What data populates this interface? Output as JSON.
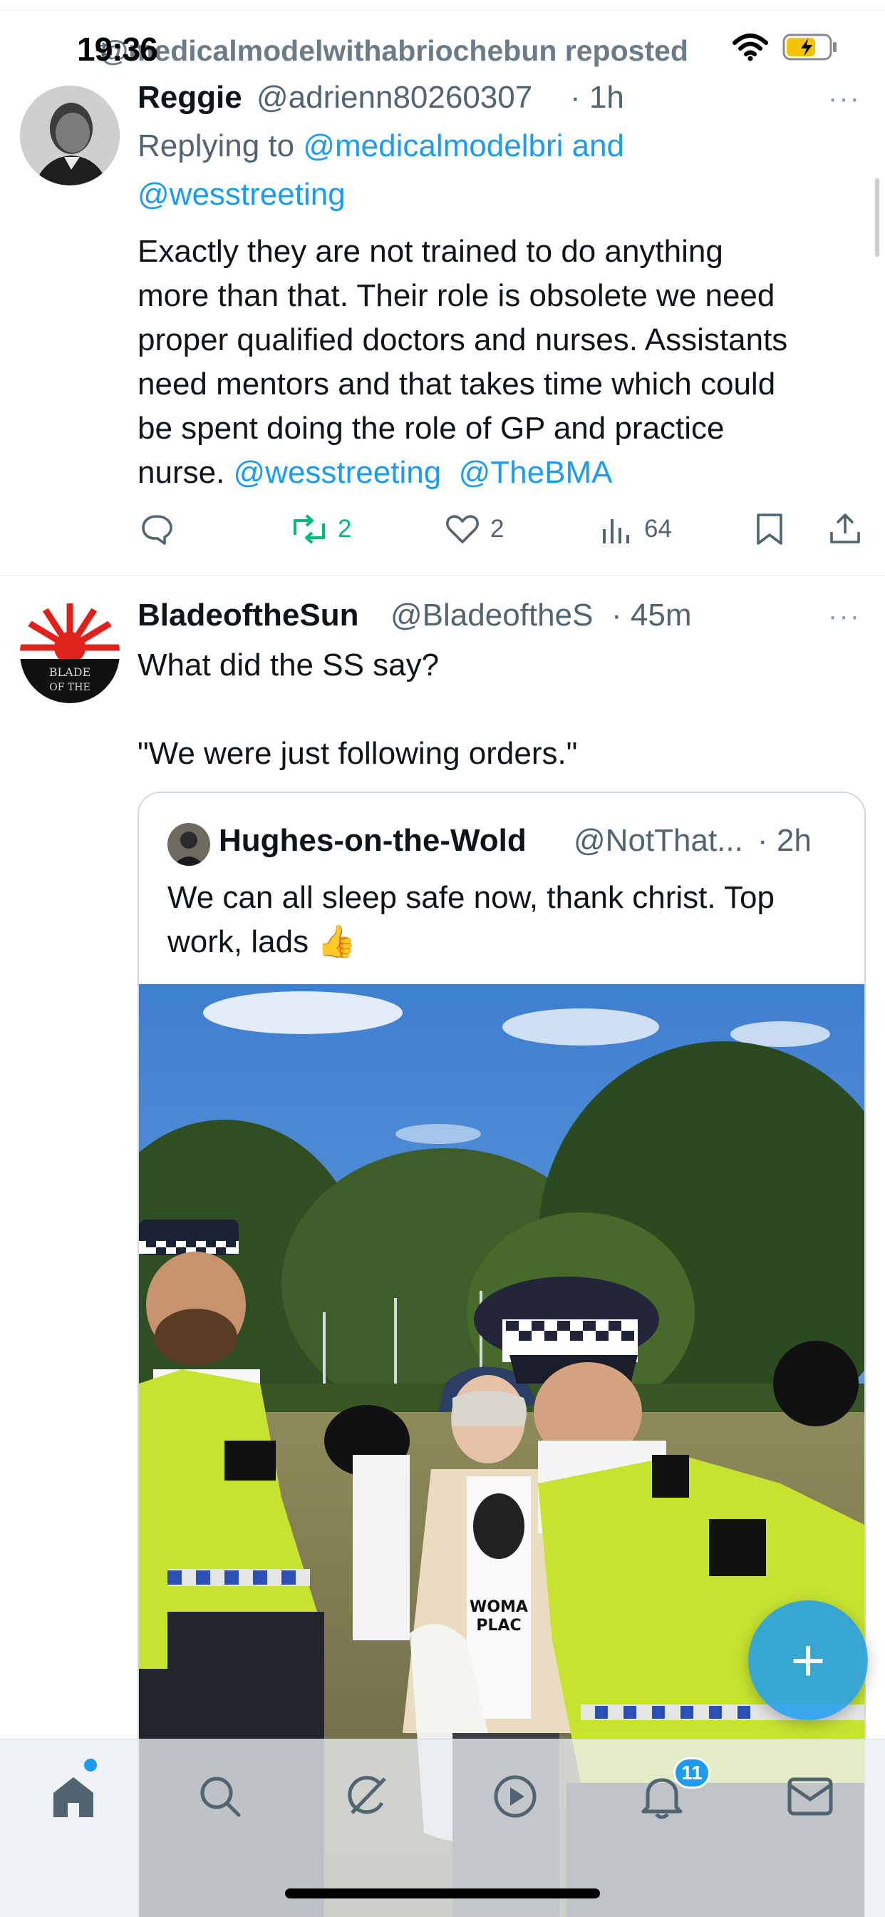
{
  "status_bar": {
    "time": "19:36"
  },
  "context": {
    "reposted_text": "@medicalmodelwithabriochebun reposted"
  },
  "tweet1": {
    "name": "Reggie",
    "handle": "@adrienn80260307",
    "time": "· 1h",
    "replying_prefix": "Replying to ",
    "replying_handle1": "@medicalmodelbri",
    "replying_and": " and",
    "replying_handle2": "@wesstreeting",
    "text_lines": [
      "Exactly they are not trained to do anything",
      "more than that. Their role is obsolete  we need",
      "proper qualified doctors and nurses. Assistants",
      "need mentors and that takes time which could",
      "be spent doing the role of GP and practice"
    ],
    "text_last_plain": "nurse. ",
    "mention1": "@wesstreeting",
    "mention2": "@TheBMA",
    "retweets": "2",
    "likes": "2",
    "views": "64",
    "more": "···"
  },
  "tweet2": {
    "name": "BladeoftheSun",
    "handle": "@BladeoftheS",
    "time": "· 45m",
    "text_line1": "What did the SS say?",
    "text_line2": "\"We were just following orders.\"",
    "avatar_text": "BLADE OF THE",
    "more": "···"
  },
  "quoted": {
    "name": "Hughes-on-the-Wold",
    "handle": "@NotThat...",
    "time": "· 2h",
    "text_line1": "We can all sleep safe now, thank christ. Top",
    "text_line2": "work, lads 👍",
    "photo_text_shirt": "WOMAN PLAC IN TH ESTAND"
  },
  "tab_bar": {
    "notifications_badge": "11",
    "tabs": [
      "home",
      "search",
      "grok",
      "video",
      "notifications",
      "messages"
    ]
  },
  "fab": {
    "label": "+"
  },
  "colors": {
    "accent": "#1d9bf0",
    "retweet_green": "#00ba7c",
    "secondary": "#536471"
  }
}
